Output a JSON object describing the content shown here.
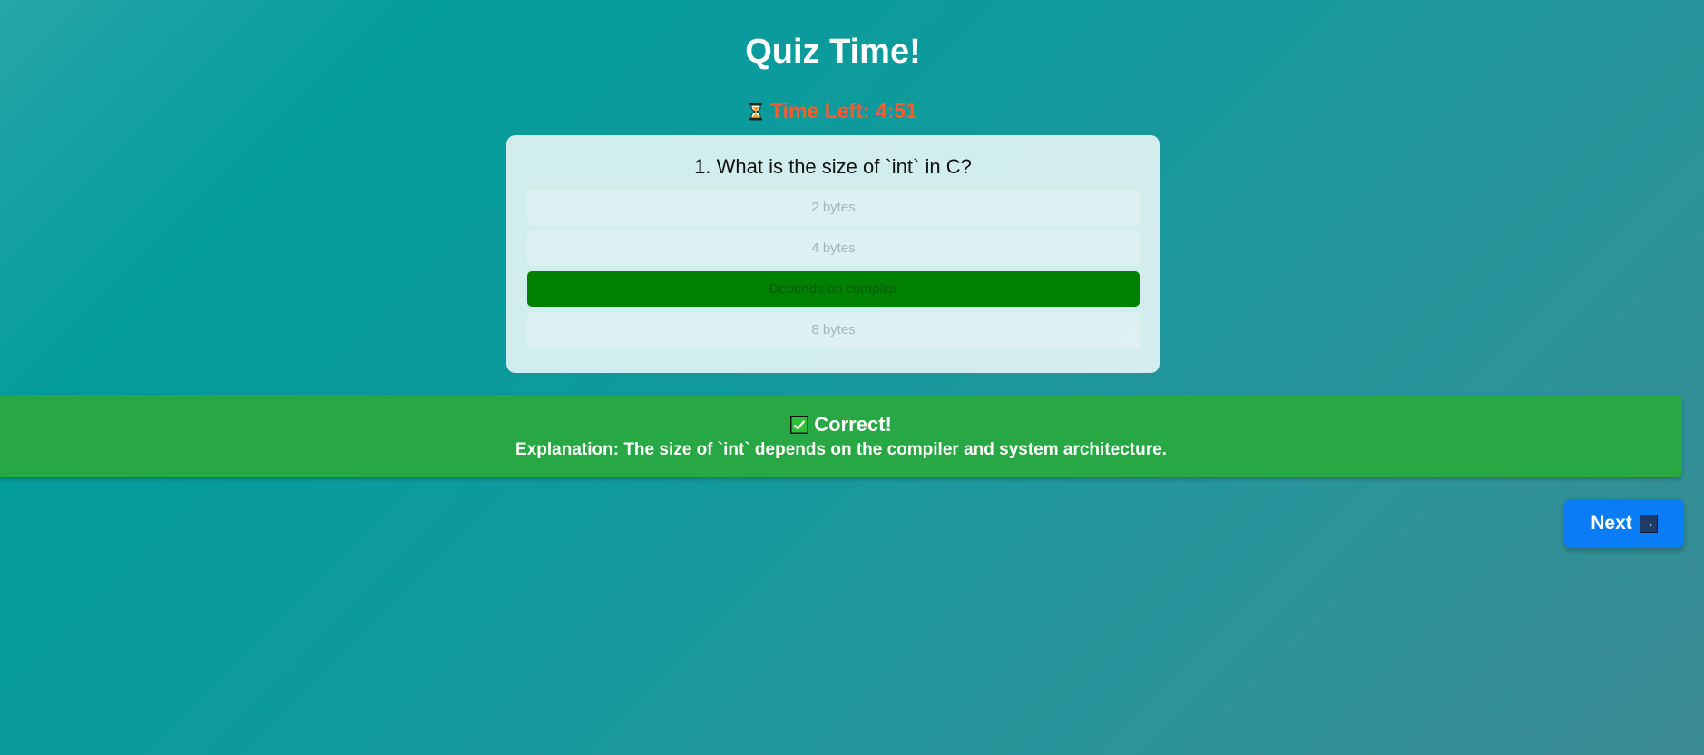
{
  "page": {
    "title": "Quiz Time!"
  },
  "timer": {
    "label": "Time Left: 4:51",
    "icon": "hourglass-icon",
    "color": "#ff5a2c"
  },
  "question": {
    "text": "1. What is the size of `int` in C?",
    "options": [
      {
        "label": "2 bytes",
        "selected": false
      },
      {
        "label": "4 bytes",
        "selected": false
      },
      {
        "label": "Depends on compiler",
        "selected": true
      },
      {
        "label": "8 bytes",
        "selected": false
      }
    ]
  },
  "feedback": {
    "status": "Correct!",
    "icon": "check-icon",
    "explanation_label": "Explanation:",
    "explanation_text": " The size of `int` depends on the compiler and system architecture.",
    "color": "#28a745"
  },
  "next_button": {
    "label": "Next",
    "icon": "arrow-right-icon",
    "color": "#0a7cf5"
  }
}
